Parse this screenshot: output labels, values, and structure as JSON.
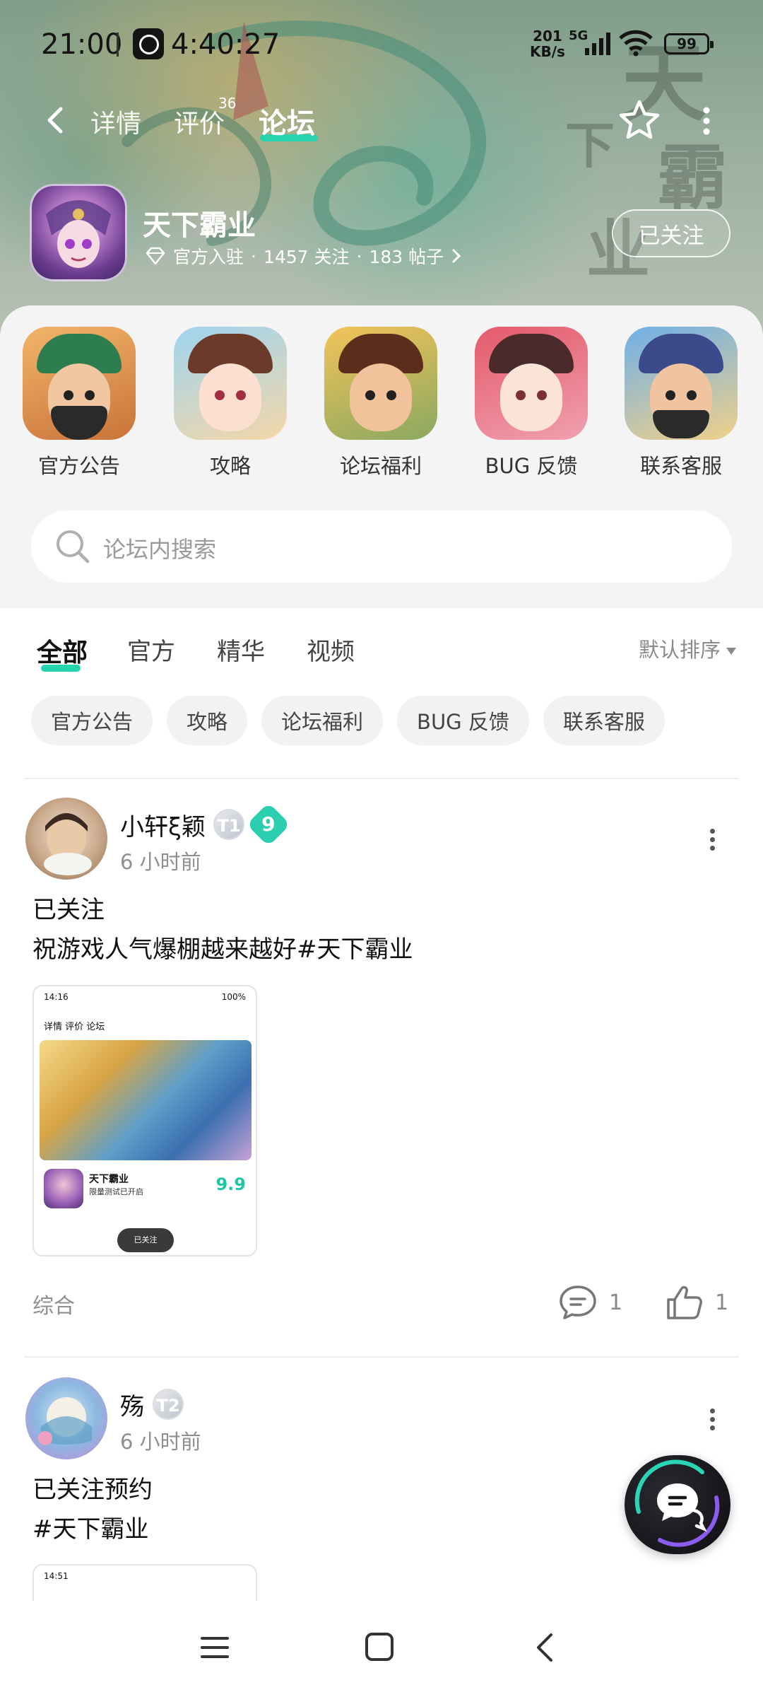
{
  "status_bar": {
    "time": "21:00",
    "timer": "4:40:27",
    "net_speed_value": "201",
    "net_speed_unit": "KB/s",
    "network": "5G",
    "battery": "99"
  },
  "nav": {
    "tabs": [
      {
        "label": "详情"
      },
      {
        "label": "评价",
        "count": "36"
      },
      {
        "label": "论坛"
      }
    ],
    "active_tab": "论坛"
  },
  "app": {
    "title": "天下霸业",
    "official": "官方入驻",
    "followers": "1457 关注",
    "posts": "183 帖子",
    "separator": "·",
    "follow_label": "已关注"
  },
  "shortcuts": [
    {
      "label": "官方公告"
    },
    {
      "label": "攻略"
    },
    {
      "label": "论坛福利"
    },
    {
      "label": "BUG 反馈"
    },
    {
      "label": "联系客服"
    }
  ],
  "search": {
    "placeholder": "论坛内搜索"
  },
  "feed_tabs": [
    "全部",
    "官方",
    "精华",
    "视频"
  ],
  "sort_label": "默认排序",
  "chips": [
    "官方公告",
    "攻略",
    "论坛福利",
    "BUG 反馈",
    "联系客服"
  ],
  "posts": [
    {
      "user": "小轩ξ颖",
      "badges": [
        "T1",
        "9"
      ],
      "time": "6 小时前",
      "lines": [
        "已关注",
        "祝游戏人气爆棚越来越好#天下霸业"
      ],
      "thumbnail": {
        "time": "14:16",
        "battery": "100%",
        "nav": "详情  评价  论坛",
        "app_title": "天下霸业",
        "app_sub": "限量测试已开启",
        "score": "9.9",
        "pill": "已关注"
      },
      "tag": "综合",
      "comments": "1",
      "likes": "1"
    },
    {
      "user": "殇",
      "badges": [
        "T2"
      ],
      "time": "6 小时前",
      "lines": [
        "已关注预约",
        "#天下霸业"
      ],
      "thumbnail": {
        "time": "14:51"
      }
    }
  ],
  "colors": {
    "accent": "#28d3b0",
    "level_badge": "#2bcfb0"
  }
}
